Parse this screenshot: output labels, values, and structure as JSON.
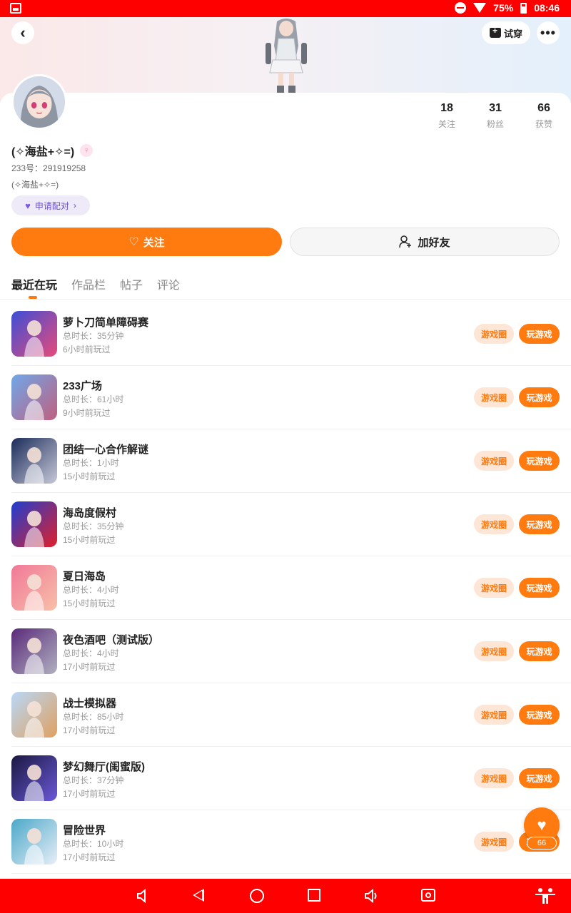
{
  "status_bar": {
    "battery": "75%",
    "time": "08:46"
  },
  "header": {
    "back_icon": "‹",
    "tryon_label": "试穿",
    "more_icon": "•••"
  },
  "profile": {
    "name": "(✧海盐+✧=)",
    "id_line": "233号：291919258",
    "bio": "(✧海盐+✧=)",
    "match_label": "申请配对",
    "stats": [
      {
        "value": "18",
        "label": "关注"
      },
      {
        "value": "31",
        "label": "粉丝"
      },
      {
        "value": "66",
        "label": "获赞"
      }
    ],
    "follow_label": "关注",
    "add_friend_label": "加好友"
  },
  "tabs": [
    "最近在玩",
    "作品栏",
    "帖子",
    "评论"
  ],
  "games": [
    {
      "name": "萝卜刀简单障碍赛",
      "duration": "总时长：35分钟",
      "last_played": "6小时前玩过",
      "colors": [
        "#3c4fd6",
        "#e84a7a"
      ]
    },
    {
      "name": "233广场",
      "duration": "总时长：61小时",
      "last_played": "9小时前玩过",
      "colors": [
        "#6fa7e8",
        "#c06080"
      ]
    },
    {
      "name": "团结一心合作解谜",
      "duration": "总时长：1小时",
      "last_played": "15小时前玩过",
      "colors": [
        "#1a2c5a",
        "#c8c8d8"
      ]
    },
    {
      "name": "海岛度假村",
      "duration": "总时长：35分钟",
      "last_played": "15小时前玩过",
      "colors": [
        "#1e3fd0",
        "#e0202a"
      ]
    },
    {
      "name": "夏日海岛",
      "duration": "总时长：4小时",
      "last_played": "15小时前玩过",
      "colors": [
        "#f07898",
        "#f8c0a8"
      ]
    },
    {
      "name": "夜色酒吧（测试版）",
      "duration": "总时长：4小时",
      "last_played": "17小时前玩过",
      "colors": [
        "#5a2a7a",
        "#b0b0c0"
      ]
    },
    {
      "name": "战士模拟器",
      "duration": "总时长：85小时",
      "last_played": "17小时前玩过",
      "colors": [
        "#b8d8f8",
        "#e0a060"
      ]
    },
    {
      "name": "梦幻舞厅(闺蜜版)",
      "duration": "总时长：37分钟",
      "last_played": "17小时前玩过",
      "colors": [
        "#1a1840",
        "#6a58d8"
      ]
    },
    {
      "name": "冒险世界",
      "duration": "总时长：10小时",
      "last_played": "17小时前玩过",
      "colors": [
        "#4aa8c8",
        "#e8eef8"
      ]
    }
  ],
  "game_actions": {
    "circle": "游戏圈",
    "play": "玩游戏"
  },
  "like_fab": {
    "count": "66"
  },
  "theme": {
    "accent": "#ff7a0f",
    "system_bar": "#ff0000"
  }
}
